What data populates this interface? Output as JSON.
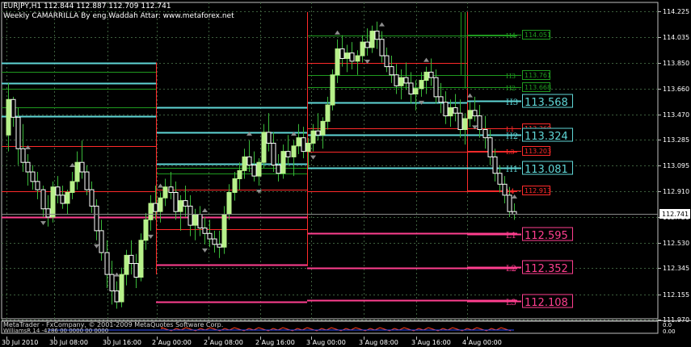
{
  "header": {
    "symbol_line": "EURJPY,H1  112.844 112.887 112.709 112.741",
    "indicator_title": "Weekly CAMARRILLA By eng.Waddah Attar: www.metaforex.net"
  },
  "footer": {
    "copyright": "MetaTrader - FxCompany, © 2001-2009 MetaQuotes Software Corp.",
    "subwindow_label": "WilliamsR 14 -4286 00 0000 00 0000"
  },
  "colors": {
    "background": "#000000",
    "grid": "#3d5f3d",
    "candle_bull": "#b7f08a",
    "candle_bear": "#ffffff",
    "wick": "#39b839",
    "green_levels": "#1f9a1f",
    "red_levels": "#ff2a2a",
    "cyan_levels": "#5fd6d6",
    "pink_levels": "#ff3f8f",
    "fractal": "#8c8c8c"
  },
  "chart_data": {
    "type": "candlestick",
    "symbol": "EURJPY",
    "timeframe": "H1",
    "price_axis": {
      "min": 111.97,
      "max": 114.225,
      "ticks": [
        "114.225",
        "114.035",
        "113.850",
        "113.660",
        "113.470",
        "113.285",
        "113.095",
        "112.910",
        "112.720",
        "112.530",
        "112.345",
        "112.155",
        "111.970"
      ]
    },
    "current_price": "112.741",
    "time_labels": [
      "30 Jul 2010",
      "30 Jul 08:00",
      "30 Jul 16:00",
      "2 Aug 00:00",
      "2 Aug 08:00",
      "2 Aug 16:00",
      "3 Aug 00:00",
      "3 Aug 08:00",
      "3 Aug 16:00",
      "4 Aug 00:00"
    ],
    "indicator_box": {
      "top": "0.0",
      "bottom": "0.00"
    },
    "camarilla_levels": [
      {
        "label": "H4",
        "value": "114.051",
        "kind": "green"
      },
      {
        "label": "H3",
        "value": "113.761",
        "kind": "green"
      },
      {
        "label": "H2",
        "value": "113.668",
        "kind": "green"
      },
      {
        "label": "H3",
        "value": "113.568",
        "kind": "cyan"
      },
      {
        "label": "L1",
        "value": "113.369",
        "kind": "red"
      },
      {
        "label": "H2",
        "value": "113.324",
        "kind": "cyan"
      },
      {
        "label": "L3",
        "value": "113.203",
        "kind": "red"
      },
      {
        "label": "H1",
        "value": "113.081",
        "kind": "cyan"
      },
      {
        "label": "L4",
        "value": "112.913",
        "kind": "red"
      },
      {
        "label": "L1",
        "value": "112.595",
        "kind": "pink"
      },
      {
        "label": "L2",
        "value": "112.352",
        "kind": "pink"
      },
      {
        "label": "L3",
        "value": "112.108",
        "kind": "pink"
      }
    ],
    "candles": [
      [
        113.32,
        113.7,
        113.2,
        113.58
      ],
      [
        113.58,
        113.6,
        113.38,
        113.45
      ],
      [
        113.45,
        113.52,
        113.1,
        113.22
      ],
      [
        113.22,
        113.4,
        113.05,
        113.12
      ],
      [
        113.12,
        113.18,
        112.95,
        113.05
      ],
      [
        113.05,
        113.1,
        112.92,
        112.98
      ],
      [
        112.98,
        113.05,
        112.85,
        112.92
      ],
      [
        112.92,
        112.95,
        112.72,
        112.78
      ],
      [
        112.78,
        112.88,
        112.65,
        112.72
      ],
      [
        112.72,
        112.98,
        112.68,
        112.94
      ],
      [
        112.94,
        113.02,
        112.82,
        112.88
      ],
      [
        112.88,
        112.95,
        112.78,
        112.82
      ],
      [
        112.82,
        112.92,
        112.74,
        112.9
      ],
      [
        112.9,
        113.05,
        112.85,
        112.98
      ],
      [
        112.98,
        113.2,
        112.92,
        113.12
      ],
      [
        113.12,
        113.28,
        113.0,
        113.05
      ],
      [
        113.05,
        113.1,
        112.88,
        112.92
      ],
      [
        112.92,
        112.98,
        112.75,
        112.8
      ],
      [
        112.8,
        112.85,
        112.55,
        112.62
      ],
      [
        112.62,
        112.7,
        112.4,
        112.46
      ],
      [
        112.46,
        112.55,
        112.2,
        112.3
      ],
      [
        112.3,
        112.4,
        112.08,
        112.18
      ],
      [
        112.18,
        112.25,
        112.05,
        112.1
      ],
      [
        112.1,
        112.35,
        112.06,
        112.3
      ],
      [
        112.3,
        112.48,
        112.22,
        112.44
      ],
      [
        112.44,
        112.55,
        112.3,
        112.38
      ],
      [
        112.38,
        112.45,
        112.2,
        112.28
      ],
      [
        112.28,
        112.6,
        112.25,
        112.55
      ],
      [
        112.55,
        112.75,
        112.48,
        112.7
      ],
      [
        112.7,
        112.88,
        112.62,
        112.82
      ],
      [
        112.82,
        112.95,
        112.7,
        112.76
      ],
      [
        112.76,
        112.9,
        112.68,
        112.86
      ],
      [
        112.86,
        113.0,
        112.8,
        112.94
      ],
      [
        112.94,
        113.05,
        112.85,
        112.9
      ],
      [
        112.9,
        112.98,
        112.7,
        112.76
      ],
      [
        112.76,
        112.88,
        112.62,
        112.84
      ],
      [
        112.84,
        112.95,
        112.72,
        112.8
      ],
      [
        112.8,
        112.88,
        112.58,
        112.66
      ],
      [
        112.66,
        112.78,
        112.55,
        112.74
      ],
      [
        112.74,
        112.8,
        112.58,
        112.64
      ],
      [
        112.64,
        112.72,
        112.52,
        112.6
      ],
      [
        112.6,
        112.7,
        112.5,
        112.56
      ],
      [
        112.56,
        112.62,
        112.46,
        112.52
      ],
      [
        112.52,
        112.62,
        112.42,
        112.5
      ],
      [
        112.5,
        112.8,
        112.45,
        112.74
      ],
      [
        112.74,
        112.96,
        112.7,
        112.9
      ],
      [
        112.9,
        113.05,
        112.84,
        113.0
      ],
      [
        113.0,
        113.12,
        112.92,
        113.06
      ],
      [
        113.06,
        113.22,
        113.0,
        113.16
      ],
      [
        113.16,
        113.28,
        113.05,
        113.1
      ],
      [
        113.1,
        113.2,
        112.98,
        113.02
      ],
      [
        113.02,
        113.15,
        112.95,
        113.12
      ],
      [
        113.12,
        113.4,
        113.08,
        113.34
      ],
      [
        113.34,
        113.48,
        113.2,
        113.26
      ],
      [
        113.26,
        113.34,
        113.05,
        113.1
      ],
      [
        113.1,
        113.18,
        112.98,
        113.04
      ],
      [
        113.04,
        113.25,
        113.0,
        113.2
      ],
      [
        113.2,
        113.32,
        113.1,
        113.16
      ],
      [
        113.16,
        113.28,
        113.02,
        113.24
      ],
      [
        113.24,
        113.4,
        113.18,
        113.3
      ],
      [
        113.3,
        113.38,
        113.15,
        113.2
      ],
      [
        113.2,
        113.3,
        113.08,
        113.26
      ],
      [
        113.26,
        113.4,
        113.2,
        113.35
      ],
      [
        113.35,
        113.48,
        113.28,
        113.32
      ],
      [
        113.32,
        113.45,
        113.22,
        113.42
      ],
      [
        113.42,
        113.6,
        113.36,
        113.54
      ],
      [
        113.54,
        113.8,
        113.5,
        113.76
      ],
      [
        113.76,
        114.02,
        113.7,
        113.95
      ],
      [
        113.95,
        114.05,
        113.82,
        113.88
      ],
      [
        113.88,
        113.98,
        113.78,
        113.92
      ],
      [
        113.92,
        114.0,
        113.8,
        113.86
      ],
      [
        113.86,
        113.94,
        113.76,
        113.9
      ],
      [
        113.9,
        114.05,
        113.85,
        114.0
      ],
      [
        114.0,
        114.1,
        113.9,
        113.96
      ],
      [
        113.96,
        114.12,
        113.92,
        114.08
      ],
      [
        114.08,
        114.15,
        113.95,
        114.02
      ],
      [
        114.02,
        114.08,
        113.85,
        113.9
      ],
      [
        113.9,
        113.96,
        113.78,
        113.82
      ],
      [
        113.82,
        113.9,
        113.7,
        113.76
      ],
      [
        113.76,
        113.84,
        113.62,
        113.68
      ],
      [
        113.68,
        113.8,
        113.58,
        113.74
      ],
      [
        113.74,
        113.85,
        113.65,
        113.7
      ],
      [
        113.7,
        113.78,
        113.55,
        113.62
      ],
      [
        113.62,
        113.72,
        113.5,
        113.66
      ],
      [
        113.66,
        113.78,
        113.6,
        113.72
      ],
      [
        113.72,
        113.82,
        113.62,
        113.78
      ],
      [
        113.78,
        113.88,
        113.68,
        113.74
      ],
      [
        113.74,
        113.8,
        113.55,
        113.6
      ],
      [
        113.6,
        113.7,
        113.48,
        113.56
      ],
      [
        113.56,
        113.64,
        113.4,
        113.46
      ],
      [
        113.46,
        113.58,
        113.38,
        113.52
      ],
      [
        113.52,
        113.62,
        113.42,
        113.48
      ],
      [
        113.48,
        113.58,
        113.3,
        113.36
      ],
      [
        113.36,
        113.48,
        113.25,
        113.44
      ],
      [
        113.44,
        113.56,
        113.38,
        113.5
      ],
      [
        113.5,
        113.6,
        113.42,
        113.46
      ],
      [
        113.46,
        113.54,
        113.3,
        113.36
      ],
      [
        113.36,
        113.46,
        113.22,
        113.3
      ],
      [
        113.3,
        113.36,
        113.1,
        113.16
      ],
      [
        113.16,
        113.22,
        112.98,
        113.04
      ],
      [
        113.04,
        113.1,
        112.9,
        112.96
      ],
      [
        112.96,
        113.02,
        112.82,
        112.88
      ],
      [
        112.88,
        112.94,
        112.72,
        112.76
      ],
      [
        112.76,
        112.82,
        112.7,
        112.74
      ]
    ]
  }
}
